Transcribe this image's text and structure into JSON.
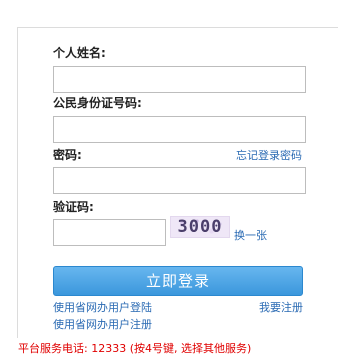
{
  "form": {
    "name_label": "个人姓名:",
    "name_value": "",
    "id_label": "公民身份证号码:",
    "id_value": "",
    "password_label": "密码:",
    "password_value": "",
    "forgot_password_link": "忘记登录密码",
    "captcha_label": "验证码:",
    "captcha_value": "",
    "captcha_text": "3000",
    "refresh_captcha_link": "换一张",
    "login_button": "立即登录",
    "provincial_login_link": "使用省网办用户登陆",
    "provincial_register_link": "使用省网办用户注册",
    "register_link": "我要注册"
  },
  "footer": {
    "service_phone": "平台服务电话: 12333 (按4号键, 选择其他服务)"
  },
  "colors": {
    "link": "#2a6ab3",
    "button": "#3b97dc",
    "footer_text": "#e00000"
  }
}
